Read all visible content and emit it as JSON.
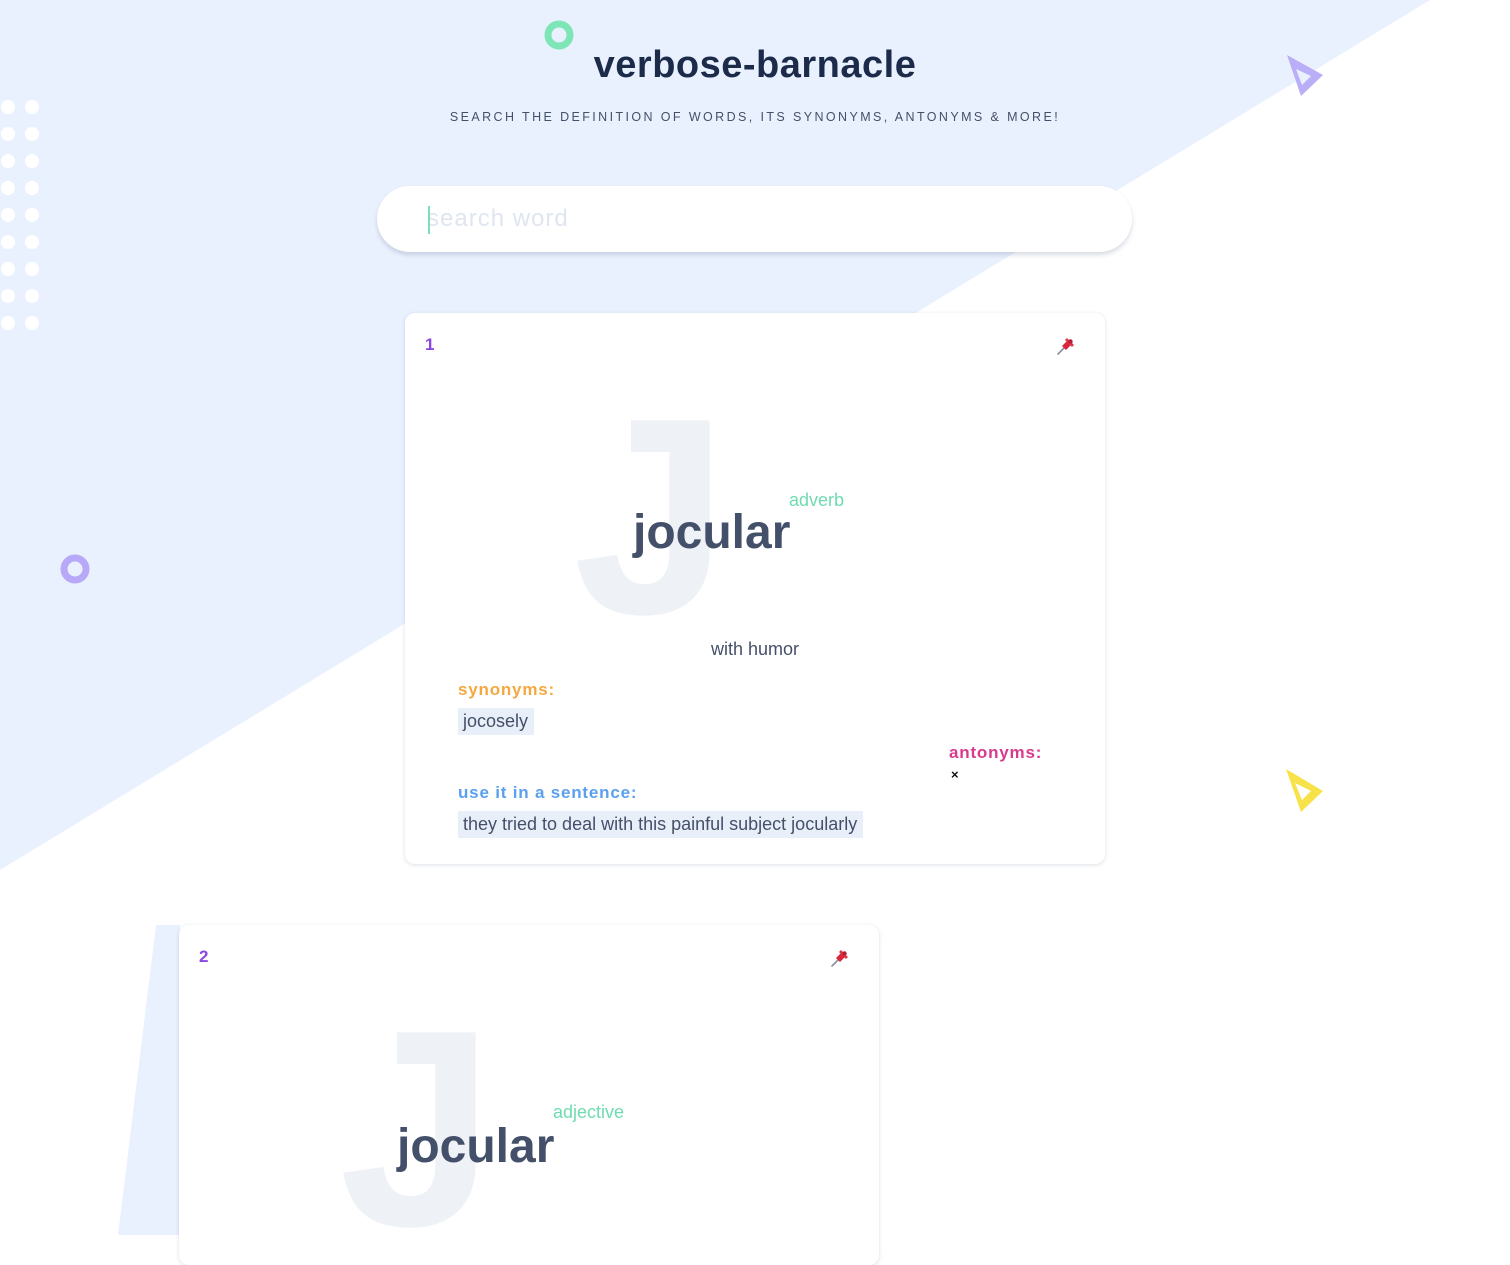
{
  "app": {
    "title": "verbose-barnacle",
    "subtitle": "SEARCH THE DEFINITION OF WORDS, ITS SYNONYMS, ANTONYMS & MORE!"
  },
  "search": {
    "placeholder": "search word",
    "value": ""
  },
  "labels": {
    "synonyms": "synonyms:",
    "antonyms": "antonyms:",
    "sentence": "use it in a sentence:"
  },
  "cards": [
    {
      "index": "1",
      "letter": "J",
      "word": "jocular",
      "part_of_speech": "adverb",
      "definition": "with humor",
      "synonyms": [
        "jocosely"
      ],
      "antonyms_empty_icon": "×",
      "example": "they tried to deal with this painful subject jocularly",
      "icon": "pushpin-icon"
    },
    {
      "index": "2",
      "letter": "J",
      "word": "jocular",
      "part_of_speech": "adjective",
      "icon": "pushpin-icon"
    }
  ],
  "colors": {
    "background_shape": "#eaf1fe",
    "accent_green": "#6fdcb0",
    "accent_purple": "#8a46e0",
    "triangle_purple": "#b9aef7",
    "triangle_yellow": "#f8e24a",
    "synonyms": "#f5a840",
    "antonyms": "#d93a8c",
    "sentence": "#5aa0ee"
  }
}
